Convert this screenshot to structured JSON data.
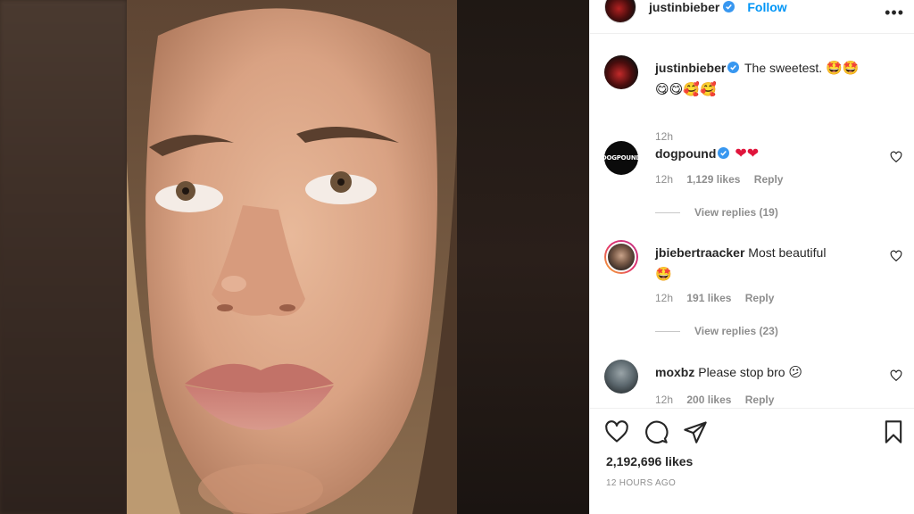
{
  "post": {
    "author": "justinbieber",
    "follow_label": "Follow",
    "more_icon": "more-horizontal-icon"
  },
  "caption": {
    "username": "justinbieber",
    "text": "The sweetest.",
    "emojis_line1": "🤩🤩",
    "emojis_line2": "😋😋🥰🥰",
    "time": "12h"
  },
  "comments": [
    {
      "username": "dogpound",
      "avatar_text": "DOGPOUND",
      "verified": true,
      "text": "❤❤",
      "time": "12h",
      "likes": "1,129 likes",
      "reply_label": "Reply",
      "view_replies": "View replies (19)"
    },
    {
      "username": "jbiebertraacker",
      "verified": false,
      "text": "Most beautiful",
      "emoji": "🤩",
      "time": "12h",
      "likes": "191 likes",
      "reply_label": "Reply",
      "view_replies": "View replies (23)"
    },
    {
      "username": "moxbz",
      "verified": false,
      "text": "Please stop bro",
      "emoji": "😕",
      "time": "12h",
      "likes": "200 likes",
      "reply_label": "Reply"
    }
  ],
  "actions": {
    "like_icon": "heart-icon",
    "comment_icon": "comment-icon",
    "share_icon": "share-icon",
    "save_icon": "bookmark-icon",
    "likes": "2,192,696 likes",
    "time_ago": "12 HOURS AGO"
  },
  "colors": {
    "link": "#0095f6",
    "verified": "#3897f0",
    "muted": "#8e8e8e",
    "text": "#262626"
  }
}
